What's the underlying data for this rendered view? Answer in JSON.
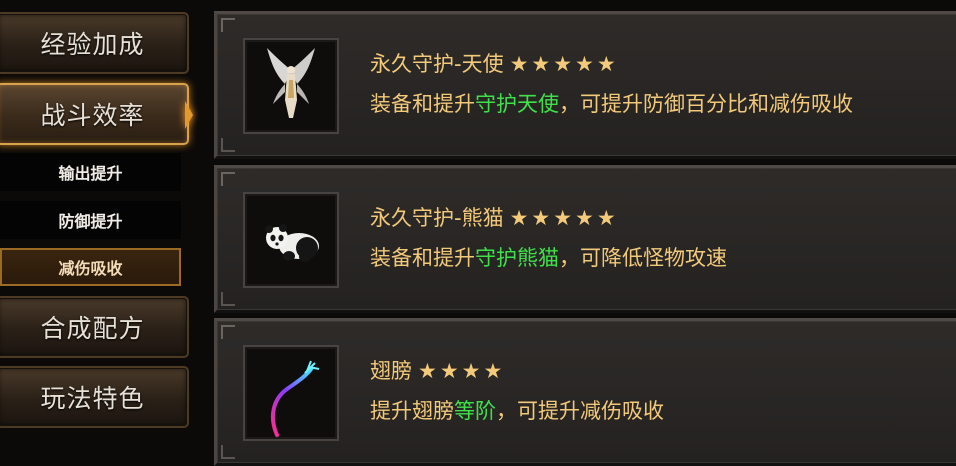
{
  "sidebar": {
    "main_items": [
      {
        "label": "经验加成"
      },
      {
        "label": "战斗效率"
      },
      {
        "label": "合成配方"
      },
      {
        "label": "玩法特色"
      }
    ],
    "sub_items": [
      {
        "label": "输出提升"
      },
      {
        "label": "防御提升"
      },
      {
        "label": "减伤吸收"
      }
    ],
    "active_main": "战斗效率",
    "selected_sub": "减伤吸收"
  },
  "items": [
    {
      "icon": "angel-icon",
      "name": "永久守护-天使",
      "stars": "★★★★★",
      "desc_before": "装备和提升",
      "desc_highlight": "守护天使",
      "desc_after": "，可提升防御百分比和减伤吸收"
    },
    {
      "icon": "panda-icon",
      "name": "永久守护-熊猫",
      "stars": "★★★★★",
      "desc_before": "装备和提升",
      "desc_highlight": "守护熊猫",
      "desc_after": "，可降低怪物攻速"
    },
    {
      "icon": "wings-icon",
      "name": "翅膀",
      "stars": "★★★★",
      "desc_before": "提升翅膀",
      "desc_highlight": "等阶",
      "desc_after": "，可提升减伤吸收"
    }
  ],
  "colors": {
    "title_gold": "#f3c97a",
    "highlight_green": "#3ee14a",
    "active_orange": "#d6a24c"
  }
}
